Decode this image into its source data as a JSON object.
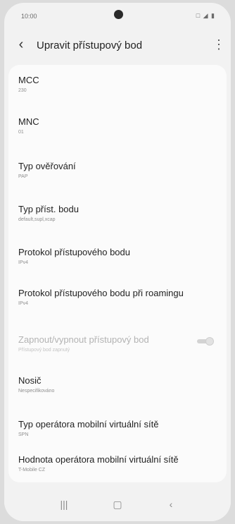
{
  "status_bar": {
    "time": "10:00",
    "icons": "□ ◢ ▮"
  },
  "appbar": {
    "back_icon": "‹",
    "title": "Upravit přístupový bod",
    "more_icon": "⋮"
  },
  "settings": [
    {
      "label": "MCC",
      "value": "230"
    },
    {
      "label": "MNC",
      "value": "01"
    },
    {
      "label": "Typ ověřování",
      "value": "PAP"
    },
    {
      "label": "Typ příst. bodu",
      "value": "default,supl,xcap"
    },
    {
      "label": "Protokol přístupového bodu",
      "value": "IPv4"
    },
    {
      "label": "Protokol přístupového bodu při roamingu",
      "value": "IPv4"
    },
    {
      "label": "Zapnout/vypnout přístupový bod",
      "value": "Přístupový bod zapnutý",
      "disabled": true,
      "toggle_on": true
    },
    {
      "label": "Nosič",
      "value": "Nespecifikováno"
    },
    {
      "label": "Typ operátora mobilní virtuální sítě",
      "value": "SPN"
    },
    {
      "label": "Hodnota operátora mobilní virtuální sítě",
      "value": "T-Mobile CZ"
    }
  ],
  "navbar": {
    "recent_icon": "|||",
    "home_icon": "▢",
    "back_icon": "‹"
  }
}
